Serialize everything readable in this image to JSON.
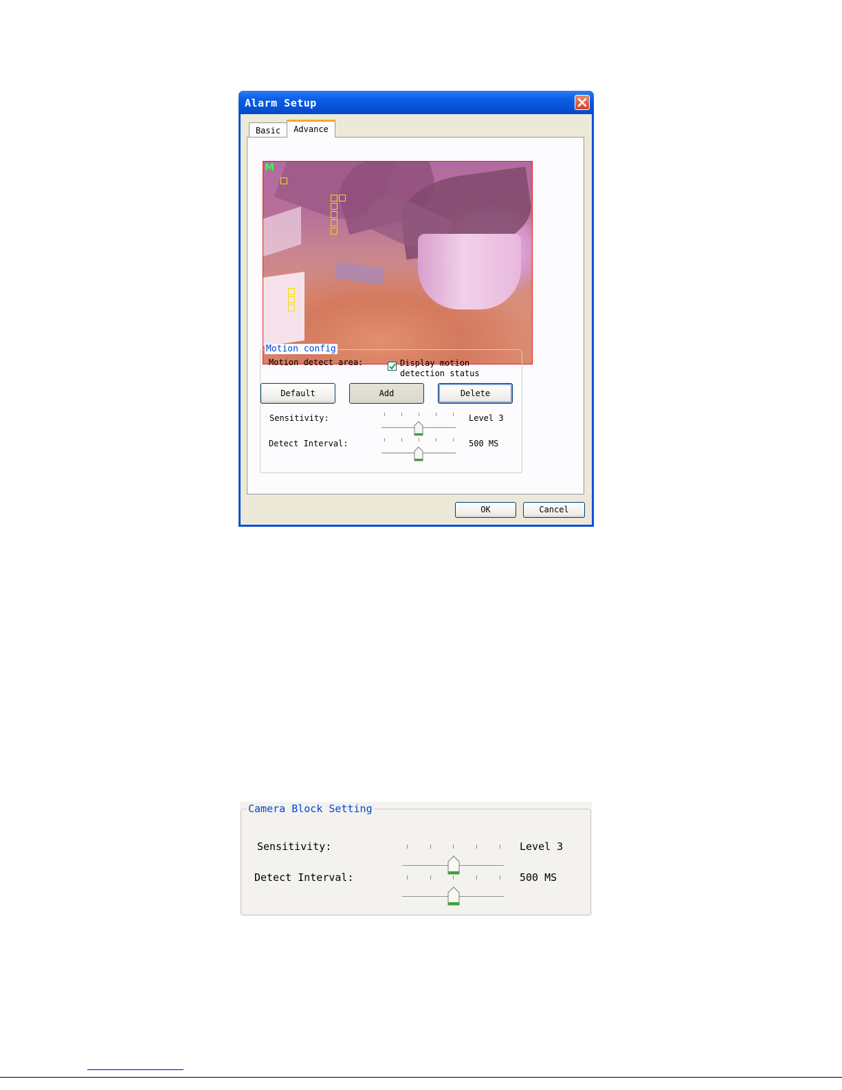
{
  "dialog": {
    "title": "Alarm Setup",
    "close_icon": "close-icon",
    "tabs": [
      {
        "label": "Basic",
        "active": false
      },
      {
        "label": "Advance",
        "active": true
      }
    ],
    "video": {
      "overlay_label": "M"
    },
    "motion_config": {
      "legend": "Motion config",
      "area_label": "Motion detect area:",
      "checkbox_label_line1": "Display motion",
      "checkbox_label_line2": "detection status",
      "checkbox_checked": true,
      "buttons": {
        "default_label": "Default",
        "add_label": "Add",
        "delete_label": "Delete"
      },
      "sensitivity": {
        "label": "Sensitivity:",
        "value_text": "Level 3",
        "position": 3,
        "ticks": 5
      },
      "interval": {
        "label": "Detect Interval:",
        "value_text": "500 MS",
        "position": 3,
        "ticks": 5
      }
    },
    "ok_label": "OK",
    "cancel_label": "Cancel"
  },
  "camera_block": {
    "legend": "Camera Block Setting",
    "sensitivity": {
      "label": "Sensitivity:",
      "value_text": "Level 3",
      "position": 3,
      "ticks": 5
    },
    "interval": {
      "label": "Detect Interval:",
      "value_text": "500 MS",
      "position": 3,
      "ticks": 5
    }
  },
  "colors": {
    "title_bar": "#0a5fe6",
    "legend_text": "#0046d5",
    "motion_box": "#f0e000",
    "video_border": "#e02020",
    "thumb_accent": "#2faa2f"
  }
}
